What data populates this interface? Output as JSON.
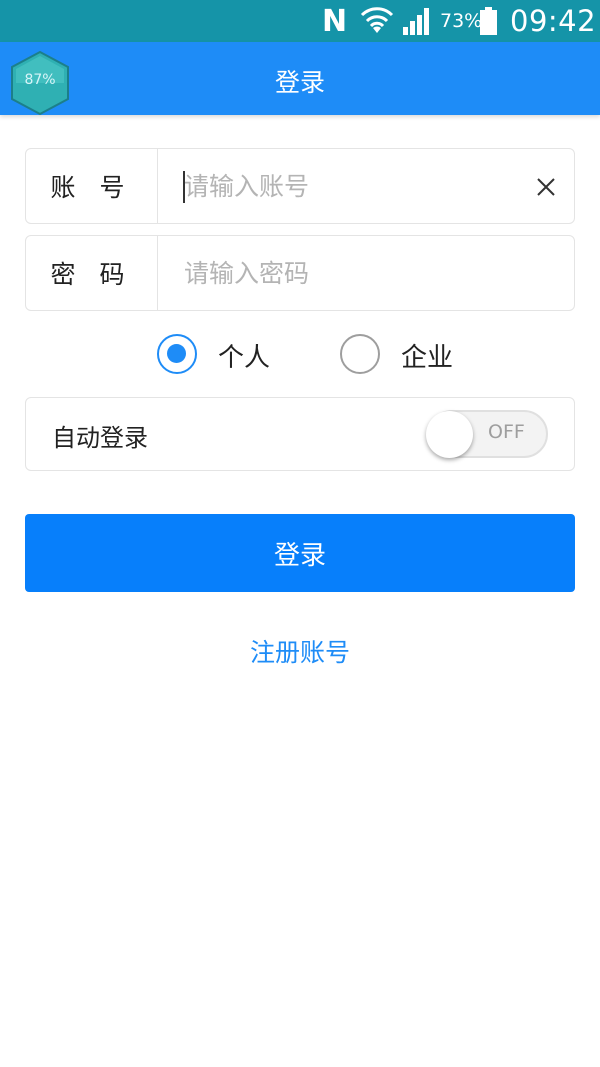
{
  "status_bar": {
    "carrier_icon_text": "N",
    "battery_percent": "73%",
    "time": "09:42"
  },
  "badge": {
    "text": "87%"
  },
  "app_bar": {
    "title": "登录"
  },
  "account_field": {
    "label": "账 号",
    "placeholder": "请输入账号",
    "value": ""
  },
  "password_field": {
    "label": "密 码",
    "placeholder": "请输入密码",
    "value": ""
  },
  "account_type": {
    "options": [
      {
        "label": "个人",
        "selected": true
      },
      {
        "label": "企业",
        "selected": false
      }
    ]
  },
  "auto_login": {
    "label": "自动登录",
    "state_text": "OFF"
  },
  "login_button": {
    "label": "登录"
  },
  "register_link": {
    "label": "注册账号"
  },
  "colors": {
    "status_bar": "#1594a8",
    "app_bar": "#1e8cf7",
    "primary_button": "#077ffb",
    "link": "#1e8cf7"
  }
}
